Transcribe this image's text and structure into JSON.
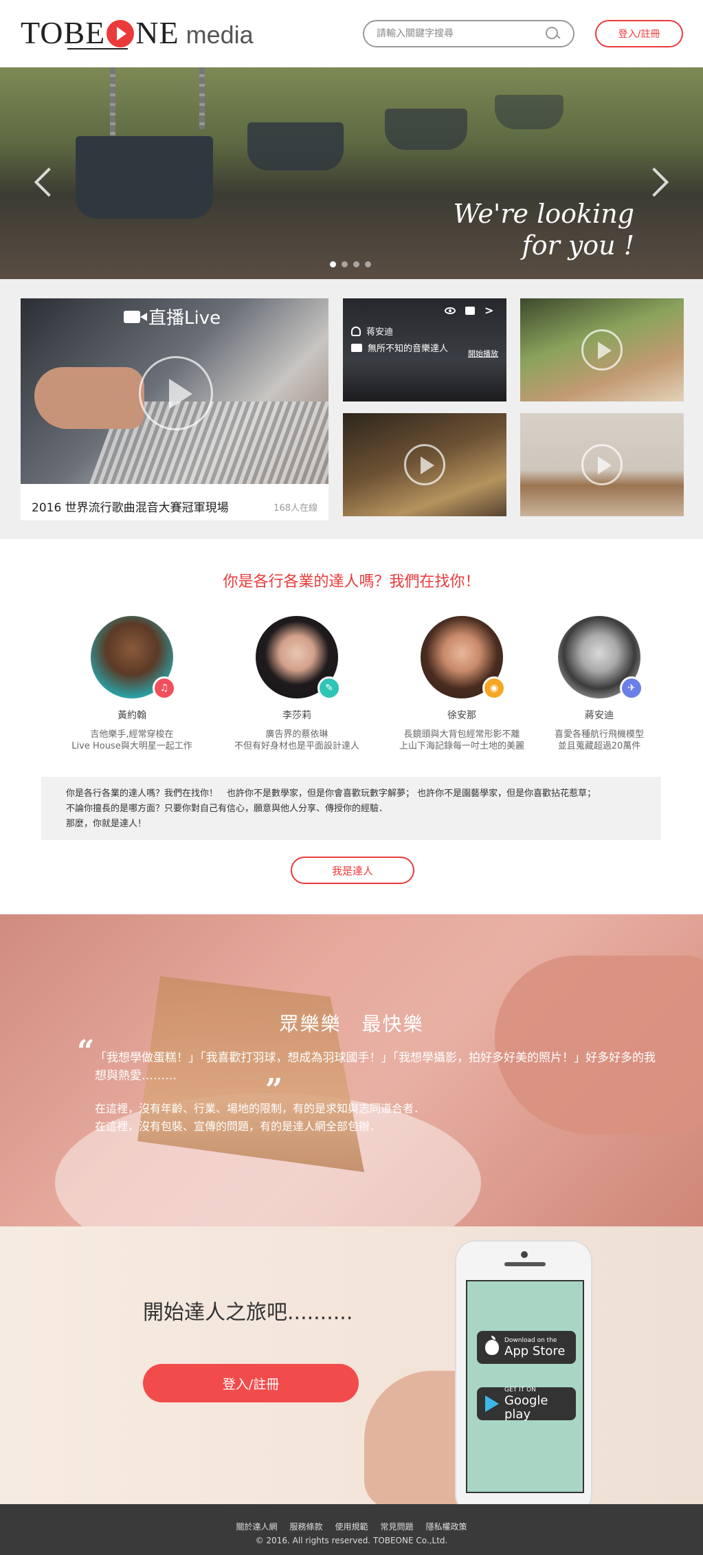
{
  "header": {
    "logo_brand_left": "TOBE",
    "logo_brand_right": "NE",
    "logo_media": "media",
    "search_placeholder": "請輸入關鍵字搜尋",
    "login_label": "登入/註冊"
  },
  "hero": {
    "line1": "We're looking",
    "line2": "for you !",
    "slide_count": 4,
    "active_slide": 1
  },
  "videos": {
    "live_label": "直播Live",
    "live_caption": "2016 世界流行歌曲混音大賽冠軍現場",
    "live_viewers": "168人在線",
    "featured_user": "蒋安迪",
    "featured_desc": "無所不知的音樂達人",
    "featured_play": "開始播放"
  },
  "talents": {
    "title": "你是各行各業的達人嗎？我們在找你！",
    "people": [
      {
        "name": "黃約翰",
        "desc1": "吉他樂手,經常穿梭在",
        "desc2": "Live House與大明星一起工作",
        "badge_color": "#f0505c",
        "badge_icon": "music-note-icon"
      },
      {
        "name": "李莎莉",
        "desc1": "廣告界的蔡依琳",
        "desc2": "不但有好身材也是平面設計達人",
        "badge_color": "#2ec4b6",
        "badge_icon": "brush-icon"
      },
      {
        "name": "徐安那",
        "desc1": "長鏡頭與大背包經常形影不離",
        "desc2": "上山下海記錄每一吋土地的美麗",
        "badge_color": "#f5a623",
        "badge_icon": "camera-icon"
      },
      {
        "name": "蔣安迪",
        "desc1": "喜愛各種航行飛機模型",
        "desc2": "並且蒐藏超過20萬件",
        "badge_color": "#6b7fe8",
        "badge_icon": "airplane-icon"
      }
    ],
    "intro_line1": "你是各行各業的達人嗎？我們在找你！　也許你不是數學家，但是你會喜歡玩數字解夢；  也許你不是園藝學家，但是你喜歡拈花惹草；",
    "intro_line2": "不論你擅長的是哪方面？只要你對自己有信心，願意與他人分享、傳授你的經驗．",
    "intro_line3": "那麼，你就是達人！",
    "button_label": "我是達人"
  },
  "cake": {
    "title": "眾樂樂　最快樂",
    "quote": "「我想學做蛋糕！」「我喜歡打羽球，想成為羽球國手！」「我想學攝影，拍好多好美的照片！」好多好多的我想與熱愛………",
    "body1": "在這裡，沒有年齡、行業、場地的限制，有的是求知與志同道合者．",
    "body2": "在這裡，沒有包裝、宣傳的問題，有的是達人網全部包辦．"
  },
  "journey": {
    "title": "開始達人之旅吧..........",
    "button_label": "登入/註冊",
    "app_store_small": "Download on the",
    "app_store_big": "App Store",
    "google_small": "GET IT ON",
    "google_big": "Google play"
  },
  "footer": {
    "links": [
      "關於達人網",
      "服務條款",
      "使用規範",
      "常見問題",
      "隱私權政策"
    ],
    "copyright": "© 2016. All rights reserved. TOBEONE Co.,Ltd."
  }
}
